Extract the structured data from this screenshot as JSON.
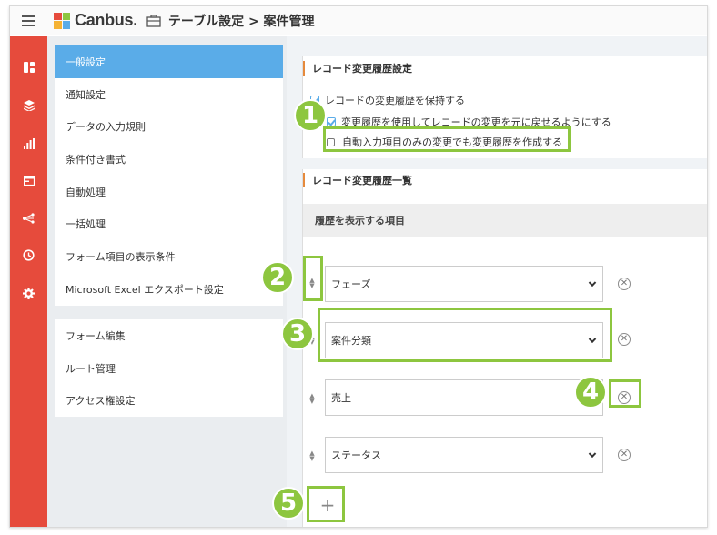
{
  "header": {
    "app_name": "Canbus.",
    "breadcrumb": "テーブル設定 > 案件管理"
  },
  "rail": {
    "icons": [
      "dashboard-icon",
      "database-icon",
      "chart-icon",
      "window-icon",
      "workflow-icon",
      "history-icon",
      "gear-icon"
    ]
  },
  "menu": {
    "group1": [
      {
        "label": "一般設定",
        "active": true
      },
      {
        "label": "通知設定"
      },
      {
        "label": "データの入力規則"
      },
      {
        "label": "条件付き書式"
      },
      {
        "label": "自動処理"
      },
      {
        "label": "一括処理"
      },
      {
        "label": "フォーム項目の表示条件"
      },
      {
        "label": "Microsoft Excel エクスポート設定"
      }
    ],
    "group2": [
      {
        "label": "フォーム編集"
      },
      {
        "label": "ルート管理"
      },
      {
        "label": "アクセス権設定"
      }
    ]
  },
  "history_settings": {
    "title": "レコード変更履歴設定",
    "keep_history": {
      "label": "レコードの変更履歴を保持する",
      "checked": true
    },
    "allow_revert": {
      "label": "変更履歴を使用してレコードの変更を元に戻せるようにする",
      "checked": true
    },
    "auto_fields_only": {
      "label": "自動入力項目のみの変更でも変更履歴を作成する",
      "checked": false
    }
  },
  "history_list": {
    "title": "レコード変更履歴一覧",
    "column_header": "履歴を表示する項目",
    "items": [
      {
        "value": "フェーズ"
      },
      {
        "value": "案件分類"
      },
      {
        "value": "売上"
      },
      {
        "value": "ステータス"
      }
    ],
    "add_label": "+"
  },
  "annotations": {
    "badges": [
      "1",
      "2",
      "3",
      "4",
      "5"
    ],
    "color": "#8dc63f"
  },
  "colors": {
    "rail": "#e64b3c",
    "active_menu": "#5aace8",
    "section_accent": "#e68a3c"
  }
}
